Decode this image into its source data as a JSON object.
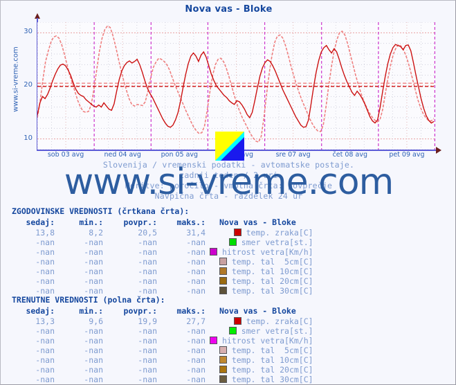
{
  "page": {
    "title": "Nova vas - Bloke",
    "site_label": "www.si-vreme.com",
    "watermark": "www.si-vreme.com",
    "subtitle_1": "Slovenija / vremenski podatki - avtomatske postaje.",
    "subtitle_2": "zadnji teden / 2 uri",
    "subtitle_3": "Meritve: poročilo - vmotna črta: povprečje",
    "subtitle_4": "Navpična črta - razdelek 24 ur",
    "logo_colors": {
      "yellow": "#ffff00",
      "cyan": "#00ffff",
      "blue": "#1a1aee"
    }
  },
  "chart_data": {
    "type": "line",
    "title": "Nova vas - Bloke",
    "xlabel": "",
    "ylabel": "",
    "ylim": [
      8,
      32
    ],
    "yticks": [
      10,
      20,
      30
    ],
    "ytick_labels": [
      "10",
      "20",
      "30"
    ],
    "xtick_labels": [
      "sob 03 avg",
      "ned 04 avg",
      "pon 05 avg",
      "tor 06 avg",
      "sre 07 avg",
      "čet 08 avg",
      "pet 09 avg"
    ],
    "grid": true,
    "legend_position": "below-chart-table",
    "day_separator_color": "#cc33cc",
    "axis_color": "#5b5bd6",
    "series": [
      {
        "name": "ZGODOVINSKE VREDNOSTI (črtkana črta) - temp. zraka[C]",
        "style": "dashed",
        "color": "#ef8080",
        "mean": 20.5,
        "values": [
          14.0,
          17.0,
          21.0,
          24.5,
          26.5,
          28.2,
          29.2,
          29.4,
          29.0,
          27.8,
          26.0,
          24.0,
          22.0,
          20.5,
          18.8,
          17.2,
          16.0,
          15.2,
          15.0,
          15.2,
          16.5,
          19.5,
          23.0,
          26.5,
          29.0,
          30.6,
          31.3,
          31.0,
          29.5,
          27.5,
          25.2,
          23.0,
          21.0,
          19.2,
          17.6,
          16.5,
          16.2,
          16.5,
          16.4,
          16.3,
          17.0,
          19.0,
          21.5,
          23.5,
          24.5,
          25.2,
          25.0,
          24.6,
          24.0,
          23.0,
          21.6,
          20.2,
          19.0,
          17.8,
          16.6,
          15.4,
          14.3,
          13.2,
          12.2,
          11.5,
          11.0,
          11.2,
          12.5,
          15.5,
          19.0,
          22.0,
          24.0,
          25.0,
          25.2,
          24.6,
          23.4,
          21.8,
          20.0,
          18.2,
          16.6,
          15.2,
          14.0,
          13.0,
          12.0,
          11.0,
          10.2,
          9.6,
          9.4,
          10.5,
          14.0,
          18.5,
          22.5,
          25.8,
          28.2,
          29.4,
          29.6,
          29.0,
          27.6,
          25.8,
          23.8,
          22.0,
          20.3,
          18.8,
          17.4,
          16.2,
          15.0,
          13.8,
          12.8,
          12.0,
          11.5,
          11.4,
          12.6,
          16.0,
          20.0,
          23.5,
          26.5,
          28.6,
          30.0,
          30.3,
          29.6,
          28.0,
          26.0,
          24.0,
          22.0,
          20.2,
          18.6,
          17.2,
          16.0,
          15.0,
          14.2,
          13.6,
          13.2,
          13.6,
          15.5,
          18.5,
          21.5,
          24.0,
          26.0,
          27.2,
          27.8,
          27.4,
          26.5,
          25.2,
          23.5,
          21.5,
          19.5,
          17.5,
          16.0,
          14.8,
          14.0,
          13.5,
          13.4,
          13.8
        ]
      },
      {
        "name": "TRENUTNE VREDNOSTI (polna črta) - temp. zraka[C]",
        "style": "solid",
        "color": "#cc1111",
        "mean": 19.9,
        "values": [
          14.5,
          16.8,
          18.0,
          17.6,
          18.4,
          19.6,
          21.0,
          22.2,
          23.2,
          23.9,
          24.1,
          23.8,
          23.0,
          22.0,
          20.6,
          19.4,
          18.6,
          18.2,
          18.0,
          17.4,
          17.0,
          16.6,
          16.2,
          16.0,
          16.4,
          16.0,
          16.8,
          16.2,
          15.6,
          15.4,
          16.6,
          19.0,
          21.2,
          22.8,
          23.8,
          24.4,
          24.7,
          24.3,
          24.6,
          25.0,
          24.0,
          22.6,
          21.0,
          19.6,
          18.6,
          17.8,
          16.8,
          15.8,
          14.8,
          13.8,
          13.0,
          12.4,
          12.2,
          12.6,
          13.6,
          15.0,
          17.2,
          19.8,
          22.2,
          24.2,
          25.6,
          26.2,
          25.6,
          24.6,
          25.8,
          26.4,
          25.4,
          23.8,
          22.2,
          21.0,
          20.0,
          19.4,
          18.8,
          18.2,
          17.8,
          17.2,
          16.8,
          16.5,
          17.2,
          17.0,
          16.4,
          15.6,
          14.6,
          14.0,
          15.0,
          17.2,
          19.6,
          21.8,
          23.4,
          24.4,
          24.9,
          24.6,
          23.8,
          22.8,
          21.6,
          20.4,
          19.2,
          18.2,
          17.2,
          16.2,
          15.2,
          14.2,
          13.4,
          12.6,
          12.2,
          12.3,
          13.6,
          16.6,
          19.8,
          22.6,
          24.8,
          26.4,
          27.2,
          27.6,
          26.8,
          26.2,
          27.0,
          26.4,
          25.0,
          23.4,
          22.0,
          20.8,
          19.8,
          18.8,
          18.2,
          19.0,
          18.4,
          17.6,
          16.6,
          15.4,
          14.2,
          13.4,
          13.0,
          13.6,
          16.0,
          19.0,
          21.8,
          24.2,
          26.0,
          27.2,
          27.8,
          27.6,
          27.4,
          26.8,
          27.6,
          27.7,
          26.6,
          24.4,
          22.0,
          19.8,
          17.6,
          15.8,
          14.4,
          13.5,
          13.0,
          13.3
        ]
      }
    ]
  },
  "historical": {
    "heading": "ZGODOVINSKE VREDNOSTI (črtkana črta):",
    "columns": [
      "sedaj:",
      "min.:",
      "povpr.:",
      "maks.:",
      "Nova vas - Bloke"
    ],
    "rows": [
      {
        "sedaj": "13,8",
        "min": "8,2",
        "povpr": "20,5",
        "maks": "31,4",
        "color": "#cc0000",
        "label": "temp. zraka[C]"
      },
      {
        "sedaj": "-nan",
        "min": "-nan",
        "povpr": "-nan",
        "maks": "-nan",
        "color": "#00dd00",
        "label": "smer vetra[st.]"
      },
      {
        "sedaj": "-nan",
        "min": "-nan",
        "povpr": "-nan",
        "maks": "-nan",
        "color": "#cc00cc",
        "label": "hitrost vetra[Km/h]"
      },
      {
        "sedaj": "-nan",
        "min": "-nan",
        "povpr": "-nan",
        "maks": "-nan",
        "color": "#c8a0a0",
        "label": "temp. tal  5cm[C]"
      },
      {
        "sedaj": "-nan",
        "min": "-nan",
        "povpr": "-nan",
        "maks": "-nan",
        "color": "#b07828",
        "label": "temp. tal 10cm[C]"
      },
      {
        "sedaj": "-nan",
        "min": "-nan",
        "povpr": "-nan",
        "maks": "-nan",
        "color": "#9a6a10",
        "label": "temp. tal 20cm[C]"
      },
      {
        "sedaj": "-nan",
        "min": "-nan",
        "povpr": "-nan",
        "maks": "-nan",
        "color": "#5e523a",
        "label": "temp. tal 30cm[C]"
      }
    ]
  },
  "current": {
    "heading": "TRENUTNE VREDNOSTI (polna črta):",
    "columns": [
      "sedaj:",
      "min.:",
      "povpr.:",
      "maks.:",
      "Nova vas - Bloke"
    ],
    "rows": [
      {
        "sedaj": "13,3",
        "min": "9,6",
        "povpr": "19,9",
        "maks": "27,7",
        "color": "#cc0000",
        "label": "temp. zraka[C]"
      },
      {
        "sedaj": "-nan",
        "min": "-nan",
        "povpr": "-nan",
        "maks": "-nan",
        "color": "#00ee00",
        "label": "smer vetra[st.]"
      },
      {
        "sedaj": "-nan",
        "min": "-nan",
        "povpr": "-nan",
        "maks": "-nan",
        "color": "#ee00ee",
        "label": "hitrost vetra[Km/h]"
      },
      {
        "sedaj": "-nan",
        "min": "-nan",
        "povpr": "-nan",
        "maks": "-nan",
        "color": "#d8b0b0",
        "label": "temp. tal  5cm[C]"
      },
      {
        "sedaj": "-nan",
        "min": "-nan",
        "povpr": "-nan",
        "maks": "-nan",
        "color": "#c08830",
        "label": "temp. tal 10cm[C]"
      },
      {
        "sedaj": "-nan",
        "min": "-nan",
        "povpr": "-nan",
        "maks": "-nan",
        "color": "#aa7410",
        "label": "temp. tal 20cm[C]"
      },
      {
        "sedaj": "-nan",
        "min": "-nan",
        "povpr": "-nan",
        "maks": "-nan",
        "color": "#6a5c40",
        "label": "temp. tal 30cm[C]"
      }
    ]
  }
}
